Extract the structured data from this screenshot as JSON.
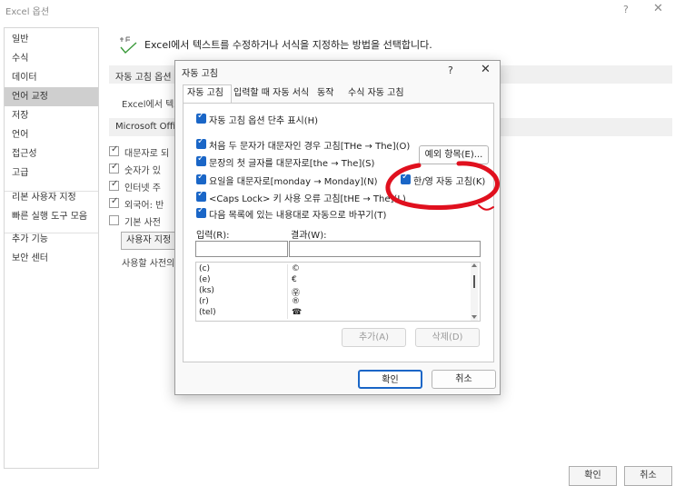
{
  "window": {
    "title": "Excel 옵션",
    "help": "?",
    "close": "✕"
  },
  "sidebar": {
    "items": [
      {
        "label": "일반"
      },
      {
        "label": "수식"
      },
      {
        "label": "데이터"
      },
      {
        "label": "언어 교정",
        "selected": true
      },
      {
        "label": "저장"
      },
      {
        "label": "언어"
      },
      {
        "label": "접근성"
      },
      {
        "label": "고급"
      },
      {
        "label": "리본 사용자 지정"
      },
      {
        "label": "빠른 실행 도구 모음"
      },
      {
        "label": "추가 기능"
      },
      {
        "label": "보안 센터"
      }
    ]
  },
  "main": {
    "heading": "Excel에서 텍스트를 수정하거나 서식을 지정하는 방법을 선택합니다.",
    "section1": "자동 고침 옵션",
    "section1_text": "Excel에서 텍스",
    "section2": "Microsoft Offi",
    "options": [
      {
        "label": "대문자로 되",
        "checked": true
      },
      {
        "label": "숫자가 있",
        "checked": true
      },
      {
        "label": "인터넷 주",
        "checked": true
      },
      {
        "label": "외국어: 반",
        "checked": true
      },
      {
        "label": "기본 사전",
        "checked": false
      }
    ],
    "user_dict_button": "사용자 지정",
    "user_dict_text": "사용할 사전의"
  },
  "bottom": {
    "ok": "확인",
    "cancel": "취소"
  },
  "dialog": {
    "title": "자동 고침",
    "help": "?",
    "close": "✕",
    "tabs": [
      {
        "label": "자동 고침",
        "active": true
      },
      {
        "label": "입력할 때 자동 서식"
      },
      {
        "label": "동작"
      },
      {
        "label": "수식 자동 고침"
      }
    ],
    "options": {
      "show_buttons": "자동 고침 옵션 단추 표시(H)",
      "two_initial_caps": "처음 두 문자가 대문자인 경우 고침[THe → The](O)",
      "capitalize_first": "문장의 첫 글자를 대문자로[the → The](S)",
      "capitalize_days": "요일을 대문자로[monday → Monday](N)",
      "han_eng": "한/영 자동 고침(K)",
      "caps_lock": "<Caps Lock> 키 사용 오류 고침[tHE → The](L)",
      "replace_text": "다음 목록에 있는 내용대로 자동으로 바꾸기(T)"
    },
    "exceptions_button": "예외 항목(E)...",
    "col_input": "입력(R):",
    "col_result": "결과(W):",
    "list": [
      {
        "key": "(c)",
        "value": "©"
      },
      {
        "key": "(e)",
        "value": "€"
      },
      {
        "key": "(ks)",
        "value": "㉾"
      },
      {
        "key": "(r)",
        "value": "®"
      },
      {
        "key": "(tel)",
        "value": "☎"
      }
    ],
    "add_button": "추가(A)",
    "delete_button": "삭제(D)",
    "ok_button": "확인",
    "cancel_button": "취소"
  },
  "colors": {
    "accent": "#1a66c7",
    "annotation": "#e0101e",
    "selected_side": "#cfcfcf"
  }
}
